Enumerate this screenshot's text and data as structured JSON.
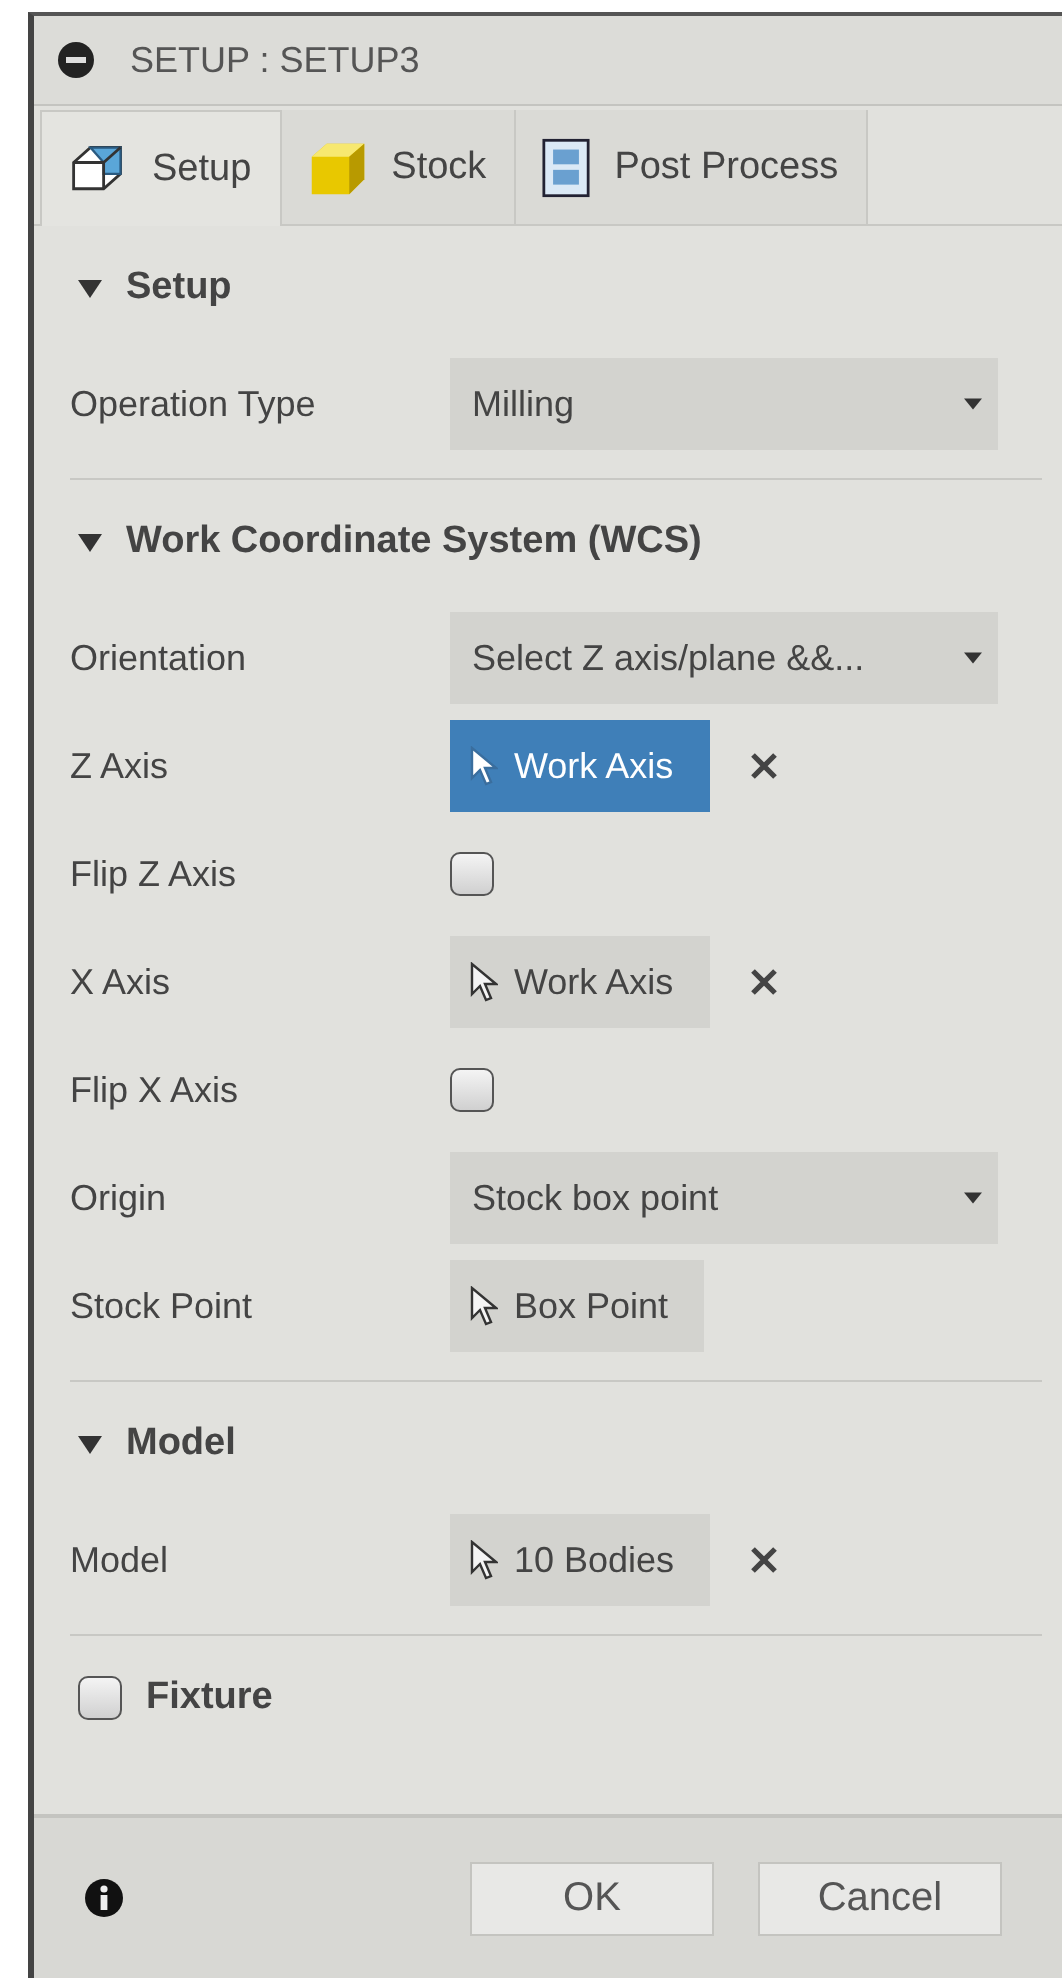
{
  "window": {
    "title": "SETUP : SETUP3"
  },
  "tabs": [
    {
      "label": "Setup",
      "kind": "setup",
      "selected": true
    },
    {
      "label": "Stock",
      "kind": "stock",
      "selected": false
    },
    {
      "label": "Post Process",
      "kind": "post",
      "selected": false
    }
  ],
  "sections": [
    {
      "kind": "group",
      "title": "Setup",
      "expanded": true,
      "rows": [
        {
          "kind": "dropdown",
          "label": "Operation Type",
          "value": "Milling"
        }
      ]
    },
    {
      "kind": "group",
      "title": "Work Coordinate System (WCS)",
      "expanded": true,
      "rows": [
        {
          "kind": "dropdown",
          "label": "Orientation",
          "value": "Select Z axis/plane &&..."
        },
        {
          "kind": "selection",
          "label": "Z Axis",
          "value": "Work Axis",
          "active": true,
          "clearable": true
        },
        {
          "kind": "checkbox",
          "label": "Flip Z Axis",
          "checked": false
        },
        {
          "kind": "selection",
          "label": "X Axis",
          "value": "Work Axis",
          "active": false,
          "clearable": true
        },
        {
          "kind": "checkbox",
          "label": "Flip X Axis",
          "checked": false
        },
        {
          "kind": "dropdown",
          "label": "Origin",
          "value": "Stock box point"
        },
        {
          "kind": "selection",
          "label": "Stock Point",
          "value": "Box Point",
          "active": false,
          "clearable": false
        }
      ]
    },
    {
      "kind": "group",
      "title": "Model",
      "expanded": true,
      "rows": [
        {
          "kind": "selection",
          "label": "Model",
          "value": "10 Bodies",
          "active": false,
          "clearable": true
        }
      ]
    },
    {
      "kind": "toggle",
      "title": "Fixture",
      "checked": false
    }
  ],
  "buttons": [
    "OK",
    "Cancel"
  ]
}
